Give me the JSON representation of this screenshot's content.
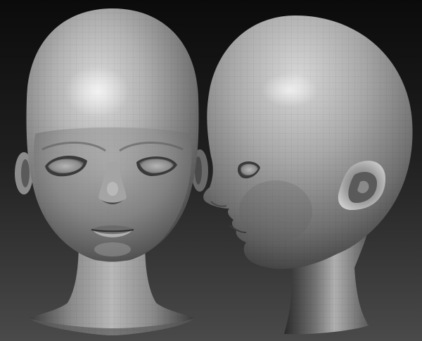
{
  "scene": {
    "subjects": [
      {
        "view": "front"
      },
      {
        "view": "profile"
      }
    ],
    "colors": {
      "background_top": "#0c0c0c",
      "background_bottom": "#4a4a4a",
      "clay_light": "#d2d2d2",
      "clay_mid": "#9a9a9a",
      "clay_dark": "#3a3a3a",
      "shadow": "#151515"
    }
  }
}
